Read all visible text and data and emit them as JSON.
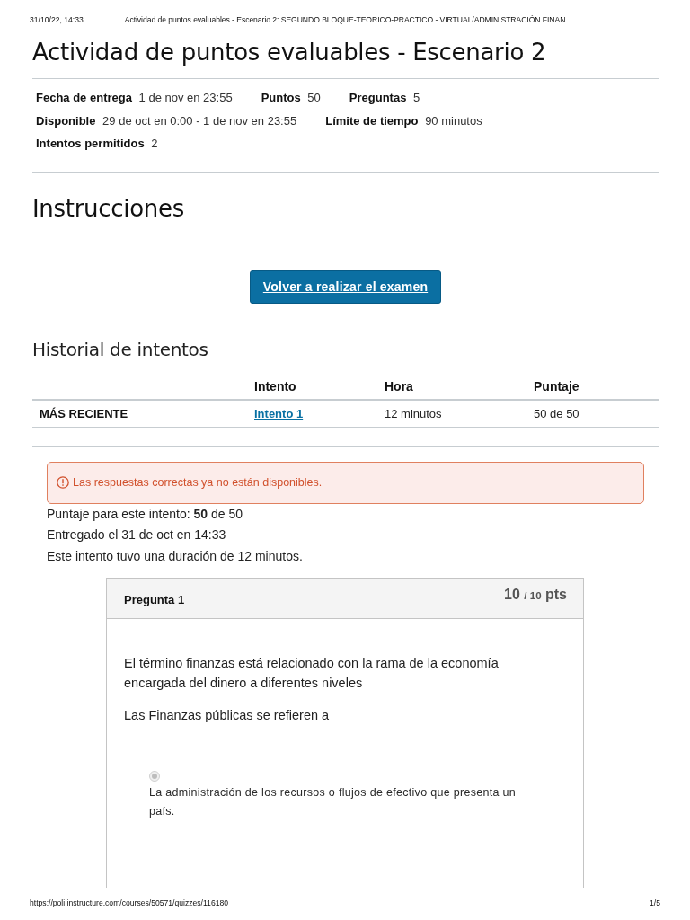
{
  "print_header": {
    "date": "31/10/22, 14:33",
    "title": "Actividad de puntos evaluables - Escenario 2: SEGUNDO BLOQUE-TEORICO-PRACTICO - VIRTUAL/ADMINISTRACIÓN FINAN..."
  },
  "title": "Actividad de puntos evaluables - Escenario 2",
  "details": [
    [
      {
        "label": "Fecha de entrega",
        "value": "1 de nov en 23:55"
      },
      {
        "label": "Puntos",
        "value": "50"
      },
      {
        "label": "Preguntas",
        "value": "5"
      }
    ],
    [
      {
        "label": "Disponible",
        "value": "29 de oct en 0:00 - 1 de nov en 23:55"
      },
      {
        "label": "Límite de tiempo",
        "value": "90 minutos"
      }
    ],
    [
      {
        "label": "Intentos permitidos",
        "value": "2"
      }
    ]
  ],
  "instructions_heading": "Instrucciones",
  "retake_button": "Volver a realizar el examen",
  "history": {
    "heading": "Historial de intentos",
    "columns": [
      "",
      "Intento",
      "Hora",
      "Puntaje"
    ],
    "rows": [
      {
        "label": "MÁS RECIENTE",
        "attempt": "Intento 1",
        "time": "12 minutos",
        "score": "50 de 50"
      }
    ]
  },
  "alert": {
    "text": "Las respuestas correctas ya no están disponibles."
  },
  "summary": [
    "Puntaje para este intento: **50** de 50",
    "Entregado el 31 de oct en 14:33",
    "Este intento tuvo una duración de 12 minutos."
  ],
  "question": {
    "title": "Pregunta 1",
    "score": "10",
    "out_of": "/ 10",
    "unit": "pts",
    "paragraphs": [
      "El término finanzas está relacionado con la rama de la economía encargada del dinero a diferentes niveles",
      "Las Finanzas públicas se refieren a"
    ],
    "answers": [
      {
        "text": "La administración de los recursos o flujos de efectivo que presenta un país.",
        "selected": true,
        "disabled": true
      }
    ]
  },
  "footer": {
    "url": "https://poli.instructure.com/courses/50571/quizzes/116180",
    "page": "1/5"
  }
}
